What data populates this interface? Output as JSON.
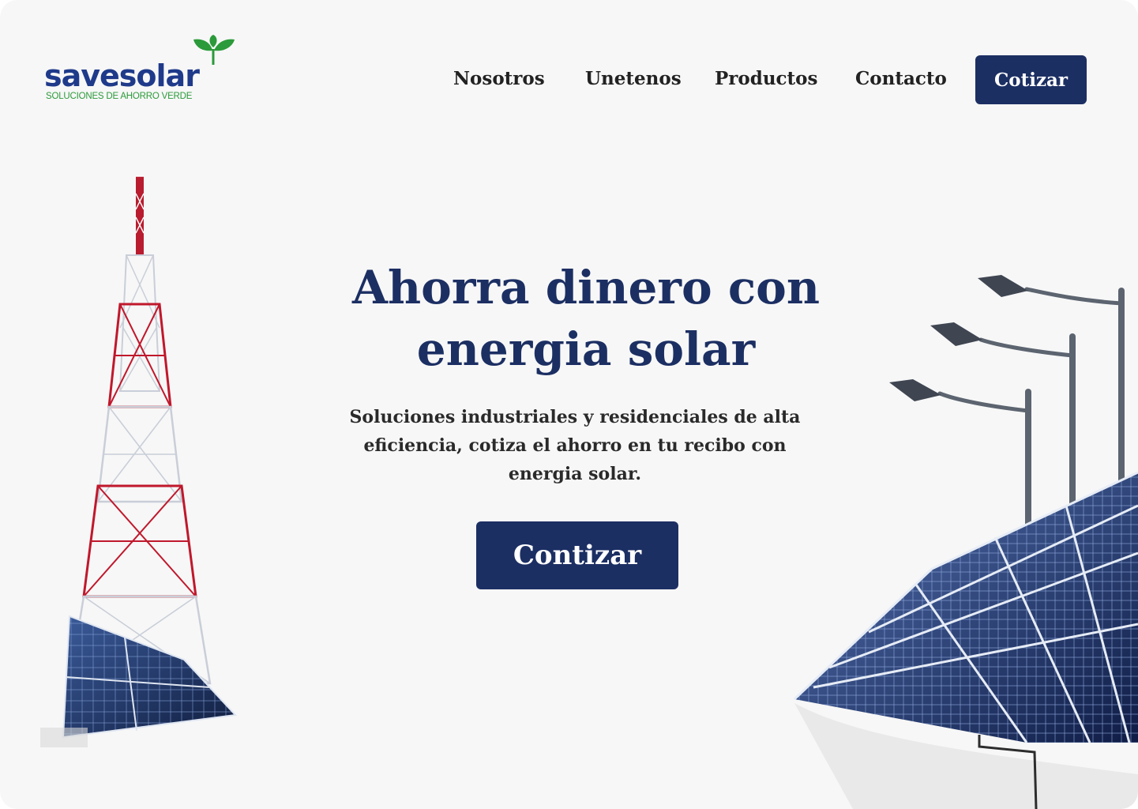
{
  "brand": {
    "logo_text": "savesolar",
    "tagline": "SOLUCIONES DE AHORRO VERDE",
    "colors": {
      "navy": "#1c2f63",
      "logo_blue": "#1f3a8a",
      "logo_green": "#2b9a3a"
    }
  },
  "nav": {
    "items": [
      "Nosotros",
      "Unetenos",
      "Productos",
      "Contacto"
    ],
    "cta_label": "Cotizar"
  },
  "hero": {
    "title": "Ahorra dinero con energia solar",
    "subtitle": "Soluciones industriales y residenciales de alta eficiencia, cotiza el ahorro en tu recibo con energia solar.",
    "cta_label": "Contizar"
  },
  "images": {
    "left": "telecom-tower-with-solar-panel",
    "right": "solar-panels-with-street-lamps"
  }
}
